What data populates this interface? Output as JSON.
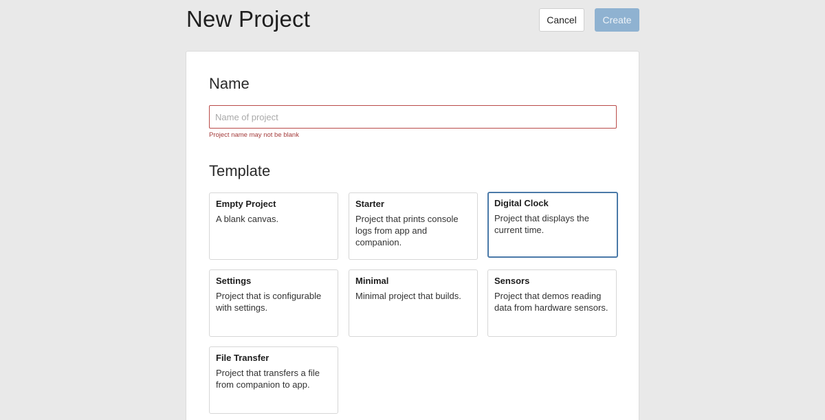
{
  "header": {
    "title": "New Project",
    "cancel_label": "Cancel",
    "create_label": "Create"
  },
  "name_section": {
    "title": "Name",
    "input_value": "",
    "input_placeholder": "Name of project",
    "error": "Project name may not be blank"
  },
  "template_section": {
    "title": "Template",
    "selected": "Digital Clock",
    "templates": [
      {
        "name": "Empty Project",
        "description": "A blank canvas."
      },
      {
        "name": "Starter",
        "description": "Project that prints console logs from app and companion."
      },
      {
        "name": "Digital Clock",
        "description": "Project that displays the current time."
      },
      {
        "name": "Settings",
        "description": "Project that is configurable with settings."
      },
      {
        "name": "Minimal",
        "description": "Minimal project that builds."
      },
      {
        "name": "Sensors",
        "description": "Project that demos reading data from hardware sensors."
      },
      {
        "name": "File Transfer",
        "description": "Project that transfers a file from companion to app."
      }
    ]
  },
  "colors": {
    "background": "#e9e9e9",
    "error": "#b94a48",
    "selected_border": "#4a79a8",
    "create_button": "#8fb2d1"
  }
}
